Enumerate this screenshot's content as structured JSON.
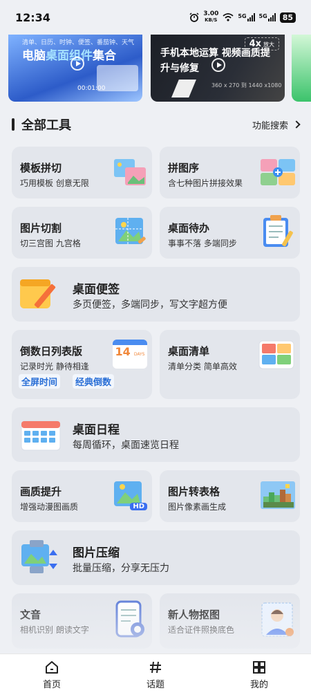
{
  "status": {
    "time": "12:34",
    "speed_value": "3.00",
    "speed_unit": "KB/S",
    "net1": "5G",
    "net2": "5G",
    "battery": "85"
  },
  "banners": [
    {
      "top_text": "清单、日历、时钟、便签、番茄钟、天气",
      "title_a": "电脑",
      "title_hl": "桌面组件",
      "title_b": "集合",
      "clock": "00:01:00"
    },
    {
      "badge": "4x",
      "badge_small": "放大",
      "title": "手机本地运算 视频画质提升与修复",
      "res": "360 x 270 到 1440 x1080"
    }
  ],
  "section": {
    "title": "全部工具",
    "link": "功能搜索"
  },
  "tools": [
    {
      "title": "模板拼切",
      "subtitle": "巧用模板 创意无限"
    },
    {
      "title": "拼图序",
      "subtitle": "含七种图片拼接效果"
    },
    {
      "title": "图片切割",
      "subtitle": "切三宫图 九宫格"
    },
    {
      "title": "桌面待办",
      "subtitle": "事事不落 多端同步"
    },
    {
      "title": "桌面便签",
      "subtitle": "多页便签，多端同步，写文字超方便"
    },
    {
      "title": "倒数日列表版",
      "subtitle": "记录时光 静待相逢",
      "tags": [
        "全屏时间",
        "经典倒数"
      ],
      "icon_text": "14",
      "icon_sub": "DAYS"
    },
    {
      "title": "桌面清单",
      "subtitle": "清单分类 简单高效"
    },
    {
      "title": "桌面日程",
      "subtitle": "每周循环，桌面速览日程"
    },
    {
      "title": "画质提升",
      "subtitle": "增强动漫图画质",
      "icon_text": "HD"
    },
    {
      "title": "图片转表格",
      "subtitle": "图片像素画生成"
    },
    {
      "title": "图片压缩",
      "subtitle": "批量压缩，分享无压力"
    },
    {
      "title": "文音",
      "subtitle": "相机识别 朗读文字"
    },
    {
      "title": "新人物抠图",
      "subtitle": "适合证件照换底色"
    }
  ],
  "nav": [
    {
      "label": "首页"
    },
    {
      "label": "话题"
    },
    {
      "label": "我的"
    }
  ],
  "colors": {
    "accent": "#2a6fd6",
    "card": "#e3e6ec",
    "background": "#eef0f4"
  }
}
